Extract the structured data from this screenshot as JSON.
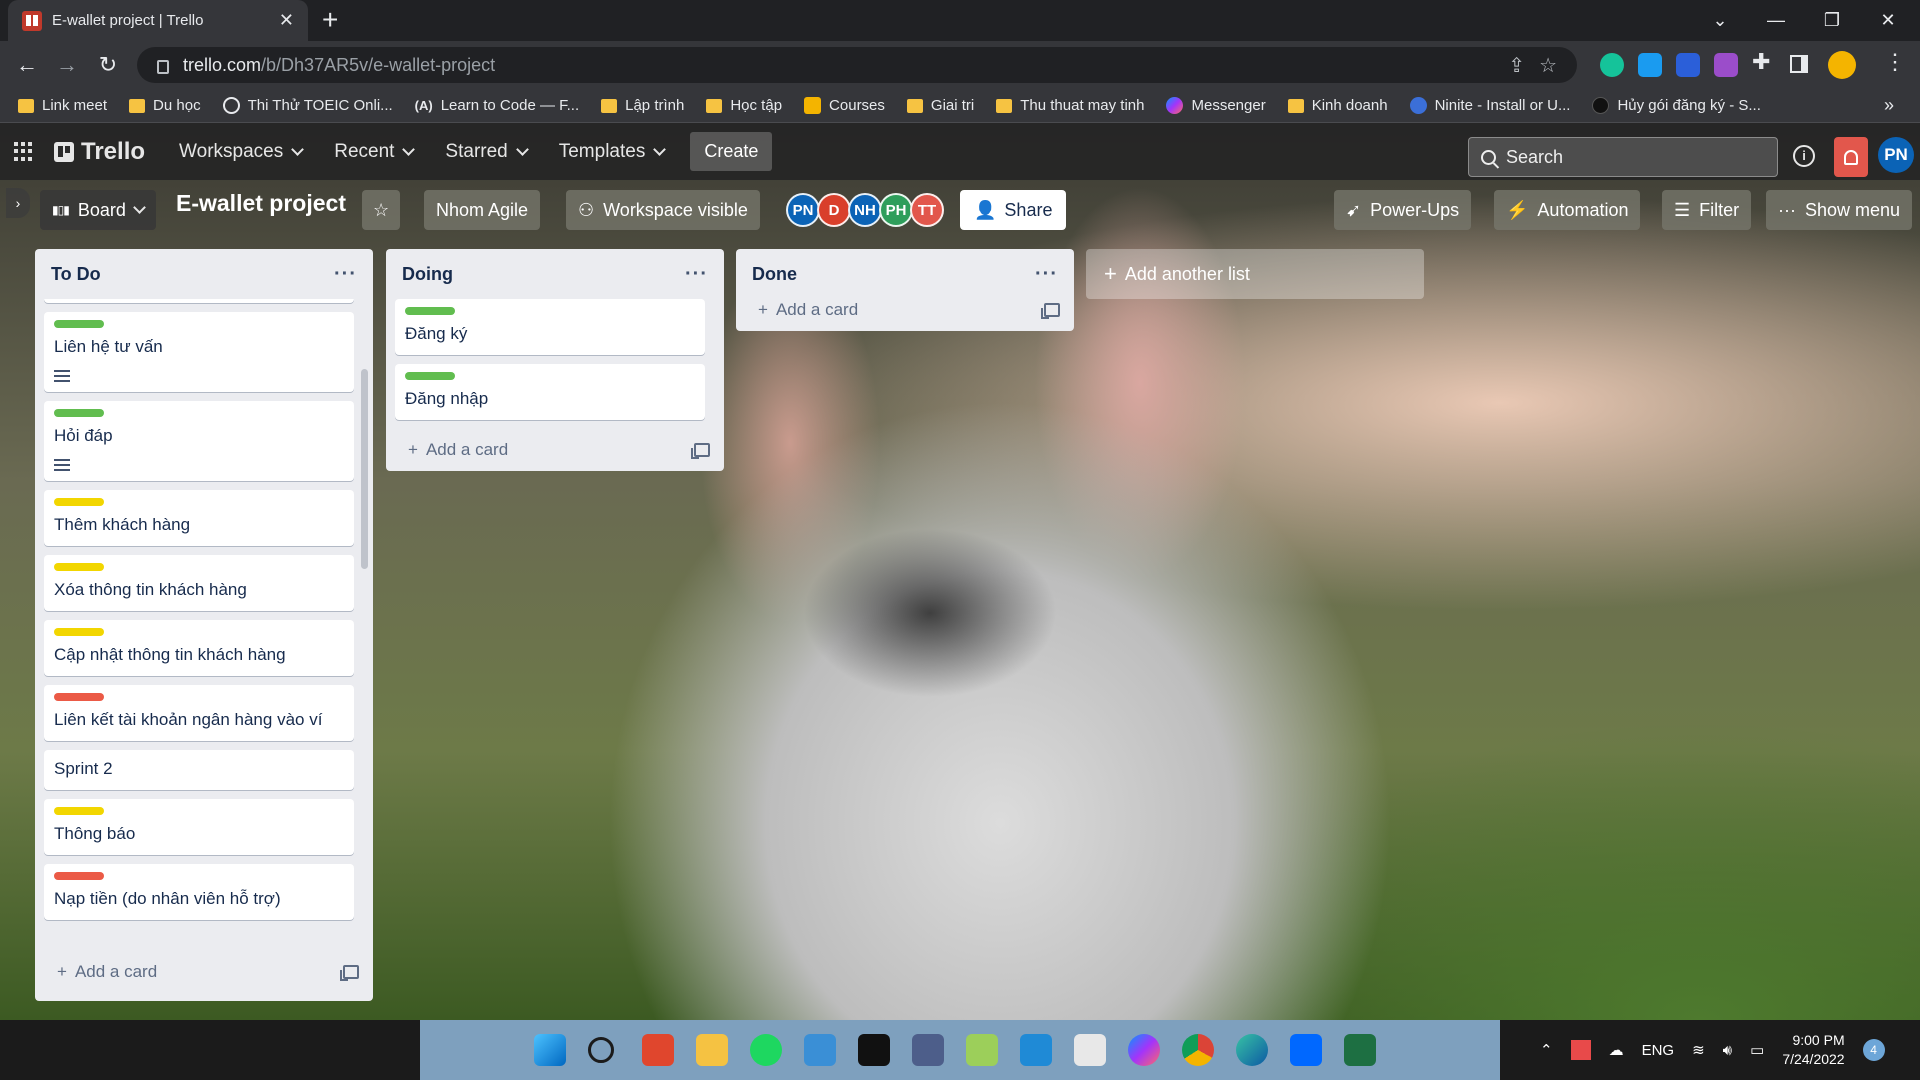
{
  "browser": {
    "tab_title": "E-wallet project | Trello",
    "url_host": "trello.com",
    "url_path": "/b/Dh37AR5v/e-wallet-project",
    "bookmarks": [
      {
        "label": "Link meet",
        "icon": "folder-icon"
      },
      {
        "label": "Du học",
        "icon": "folder-icon"
      },
      {
        "label": "Thi Thử TOEIC Onli...",
        "icon": "globe-icon"
      },
      {
        "label": "Learn to Code — F...",
        "icon": "fcc-icon"
      },
      {
        "label": "Lập trình",
        "icon": "folder-icon"
      },
      {
        "label": "Học tập",
        "icon": "folder-icon"
      },
      {
        "label": "Courses",
        "icon": "classroom-icon"
      },
      {
        "label": "Giai tri",
        "icon": "folder-icon"
      },
      {
        "label": "Thu thuat may tinh",
        "icon": "folder-icon"
      },
      {
        "label": "Messenger",
        "icon": "messenger-icon"
      },
      {
        "label": "Kinh doanh",
        "icon": "folder-icon"
      },
      {
        "label": "Ninite - Install or U...",
        "icon": "ninite-icon"
      },
      {
        "label": "Hủy gói đăng ký - S...",
        "icon": "circle-icon"
      }
    ],
    "more_bookmarks": "»"
  },
  "trello": {
    "logo": "Trello",
    "nav": {
      "workspaces": "Workspaces",
      "recent": "Recent",
      "starred": "Starred",
      "templates": "Templates",
      "create": "Create"
    },
    "search_placeholder": "Search",
    "me_initials": "PN",
    "board": {
      "view": "Board",
      "name": "E-wallet project",
      "workspace": "Nhom Agile",
      "visibility": "Workspace visible",
      "members": [
        {
          "initials": "PN",
          "color": "#0b63b6"
        },
        {
          "initials": "D",
          "color": "#d93f2b"
        },
        {
          "initials": "NH",
          "color": "#0b63b6"
        },
        {
          "initials": "PH",
          "color": "#2e9e5b"
        },
        {
          "initials": "TT",
          "color": "#e2574c"
        }
      ],
      "share": "Share",
      "power_ups": "Power-Ups",
      "automation": "Automation",
      "filter": "Filter",
      "show_menu": "Show menu"
    },
    "lists": {
      "todo": {
        "title": "To Do",
        "add_card": "Add a card",
        "cards": [
          {
            "label_color": "#61bd4f",
            "text": "Liên hệ tư vấn",
            "has_description": true
          },
          {
            "label_color": "#61bd4f",
            "text": "Hỏi đáp",
            "has_description": true
          },
          {
            "label_color": "#f2d600",
            "text": "Thêm khách hàng",
            "has_description": false
          },
          {
            "label_color": "#f2d600",
            "text": "Xóa thông tin khách hàng",
            "has_description": false
          },
          {
            "label_color": "#f2d600",
            "text": "Cập nhật thông tin khách hàng",
            "has_description": false
          },
          {
            "label_color": "#eb5a46",
            "text": "Liên kết tài khoản ngân hàng vào ví",
            "has_description": false
          },
          {
            "label_color": "",
            "text": "Sprint 2",
            "has_description": false
          },
          {
            "label_color": "#f2d600",
            "text": "Thông báo",
            "has_description": false
          },
          {
            "label_color": "#eb5a46",
            "text": "Nạp tiền (do nhân viên hỗ trợ)",
            "has_description": false
          }
        ]
      },
      "doing": {
        "title": "Doing",
        "add_card": "Add a card",
        "cards": [
          {
            "label_color": "#61bd4f",
            "text": "Đăng ký"
          },
          {
            "label_color": "#61bd4f",
            "text": "Đăng nhập"
          }
        ]
      },
      "done": {
        "title": "Done",
        "add_card": "Add a card"
      }
    },
    "add_list": "Add another list"
  },
  "taskbar": {
    "language": "ENG",
    "time": "9:00 PM",
    "date": "7/24/2022",
    "notifications": "4"
  }
}
